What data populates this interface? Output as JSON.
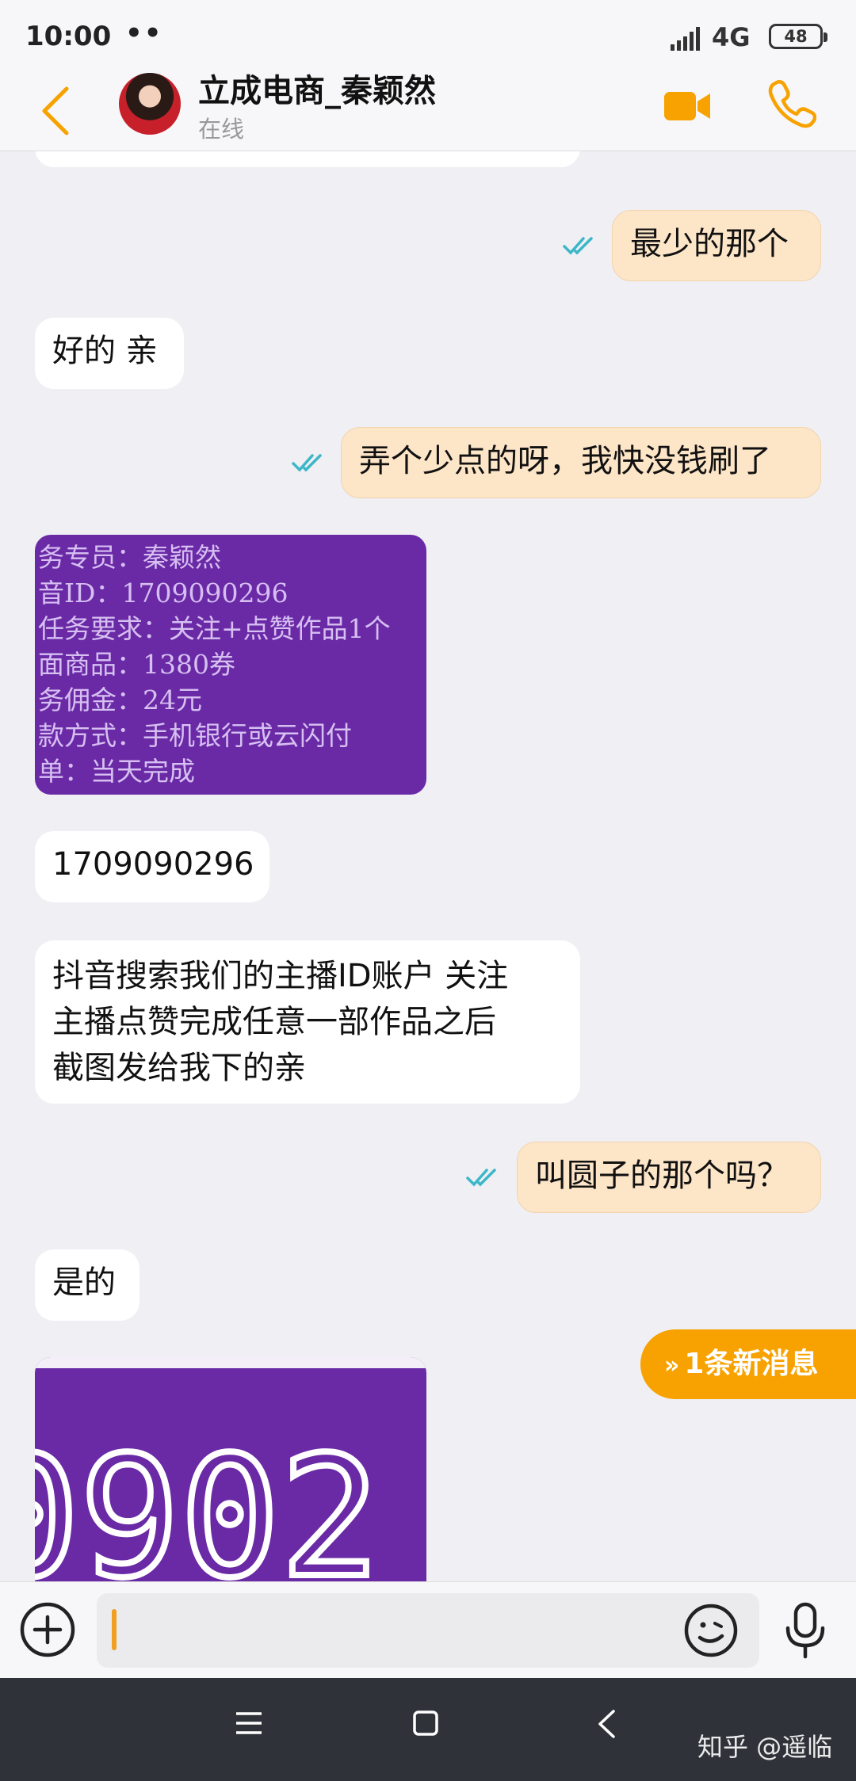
{
  "status_bar": {
    "time": "10:00",
    "dots": "••",
    "network": "4G",
    "battery": "48"
  },
  "header": {
    "contact_name": "立成电商_秦颖然",
    "contact_status": "在线"
  },
  "messages": {
    "m1": "最少的那个",
    "m2": "好的 亲",
    "m3": "弄个少点的呀，我快没钱刷了",
    "m4_image_lines": [
      "务专员：秦颖然",
      "音ID：1709090296",
      "任务要求：关注+点赞作品1个",
      "面商品：1380券",
      "务佣金：24元",
      "款方式：手机银行或云闪付",
      "单：当天完成"
    ],
    "m5": "1709090296",
    "m6_line1": "抖音搜索我们的主播ID账户 关注",
    "m6_line2": "主播点赞完成任意一部作品之后",
    "m6_line3": "截图发给我下的亲",
    "m7": "叫圆子的那个吗？",
    "m8": "是的",
    "m9_image_text": "0902"
  },
  "new_message_pill": {
    "label": "1条新消息",
    "icon": "double-chevron-down-icon"
  },
  "input": {
    "value": "",
    "placeholder": ""
  },
  "watermark": "知乎 @遥临",
  "colors": {
    "accent": "#f7a200",
    "outgoing_bubble": "#fde5c8",
    "incoming_bubble": "#ffffff",
    "read_tick": "#3cb7c8",
    "image_bg": "#6a2aa6",
    "nav_bg": "#2f3339"
  }
}
